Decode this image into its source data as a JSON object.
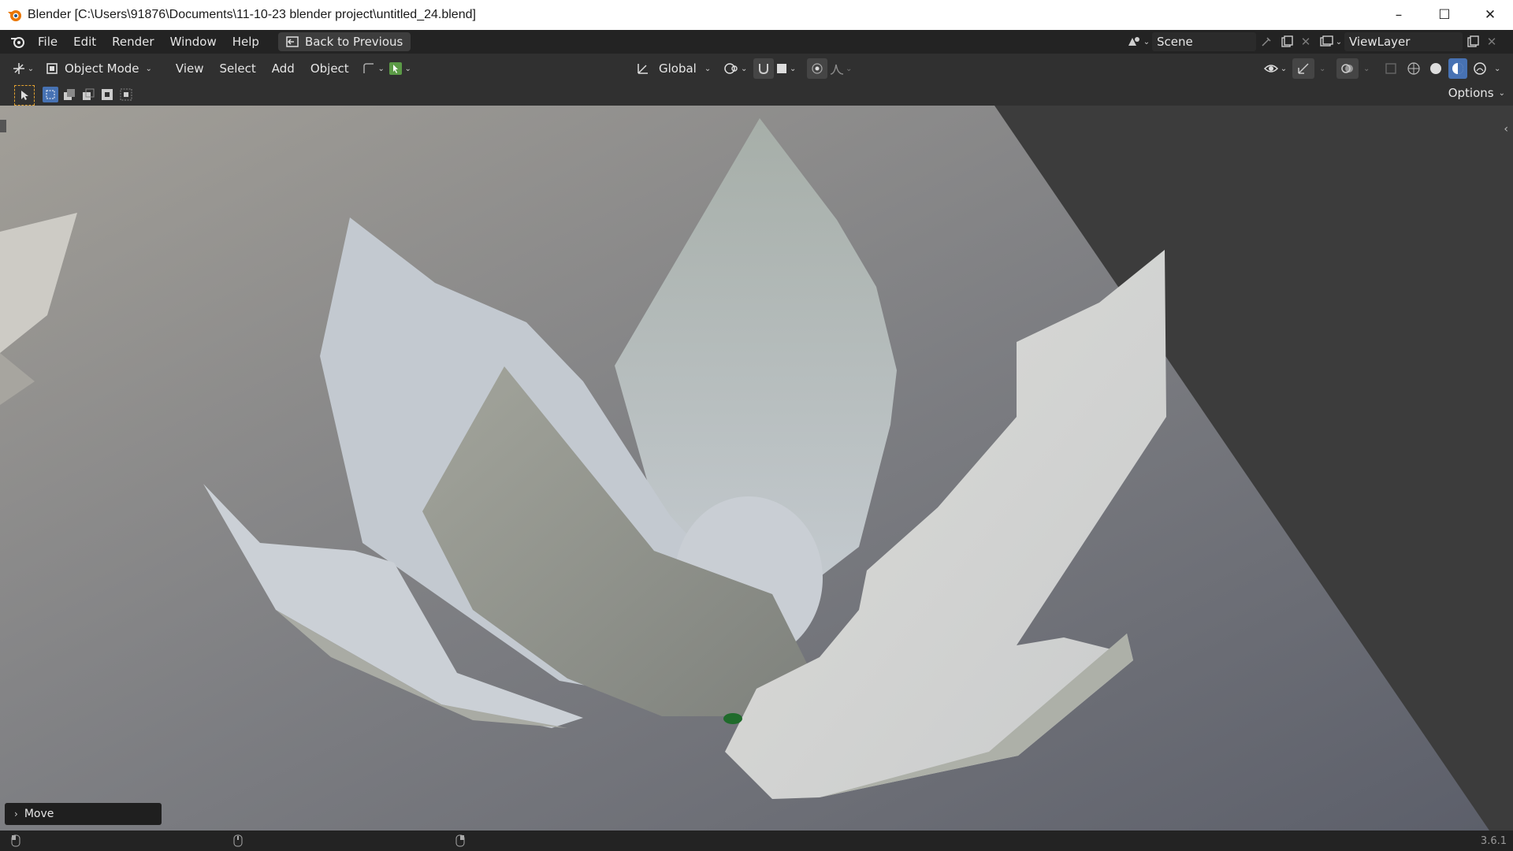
{
  "window": {
    "title": "Blender [C:\\Users\\91876\\Documents\\11-10-23 blender project\\untitled_24.blend]",
    "controls": [
      "–",
      "☐",
      "✕"
    ]
  },
  "topbar": {
    "menus": [
      "File",
      "Edit",
      "Render",
      "Window",
      "Help"
    ],
    "back_button": "Back to Previous",
    "scene_name": "Scene",
    "view_layer_name": "ViewLayer"
  },
  "header": {
    "mode": "Object Mode",
    "menus": [
      "View",
      "Select",
      "Add",
      "Object"
    ],
    "transform_orientation": "Global"
  },
  "toolrow": {
    "options_label": "Options"
  },
  "viewport": {
    "operator_panel": "Move"
  },
  "statusbar": {
    "version": "3.6.1"
  },
  "colors": {
    "accent_blue": "#4772b3",
    "active_green": "#5b9a46",
    "petal": "#d4d8dc"
  }
}
